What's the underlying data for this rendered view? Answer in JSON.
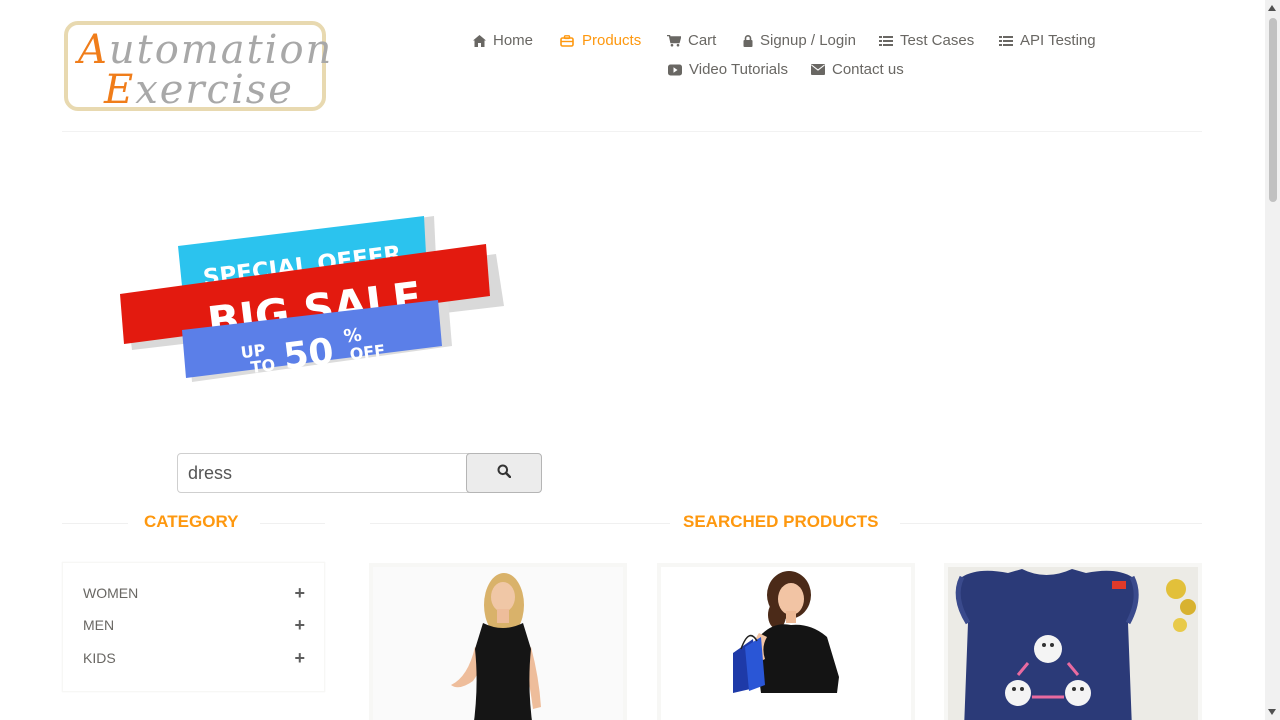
{
  "logo": {
    "line1_cap": "A",
    "line1_rest": "utomation",
    "line2_cap": "E",
    "line2_rest": "xercise"
  },
  "nav": {
    "items": [
      {
        "label": "Home",
        "icon": "home-icon"
      },
      {
        "label": "Products",
        "icon": "products-icon",
        "active": true
      },
      {
        "label": "Cart",
        "icon": "cart-icon"
      },
      {
        "label": "Signup / Login",
        "icon": "lock-icon"
      },
      {
        "label": "Test Cases",
        "icon": "list-icon"
      },
      {
        "label": "API Testing",
        "icon": "list-icon"
      },
      {
        "label": "Video Tutorials",
        "icon": "youtube-icon"
      },
      {
        "label": "Contact us",
        "icon": "envelope-icon"
      }
    ]
  },
  "banner": {
    "line1": "SPECIAL OFFER",
    "line2": "BIG SALE",
    "up": "UP",
    "to": "TO",
    "amount": "50",
    "percent": "%",
    "off": "OFF"
  },
  "search": {
    "value": "dress",
    "icon": "search-icon"
  },
  "category": {
    "title": "CATEGORY",
    "items": [
      {
        "label": "WOMEN"
      },
      {
        "label": "MEN"
      },
      {
        "label": "KIDS"
      }
    ]
  },
  "products": {
    "title": "SEARCHED PRODUCTS"
  },
  "colors": {
    "accent": "#fe980f",
    "text": "#696763",
    "sale_red": "#e31a0f",
    "sale_cyan": "#2bc3ee",
    "sale_blue": "#5b7fe8",
    "kids_navy": "#2b3a78"
  }
}
